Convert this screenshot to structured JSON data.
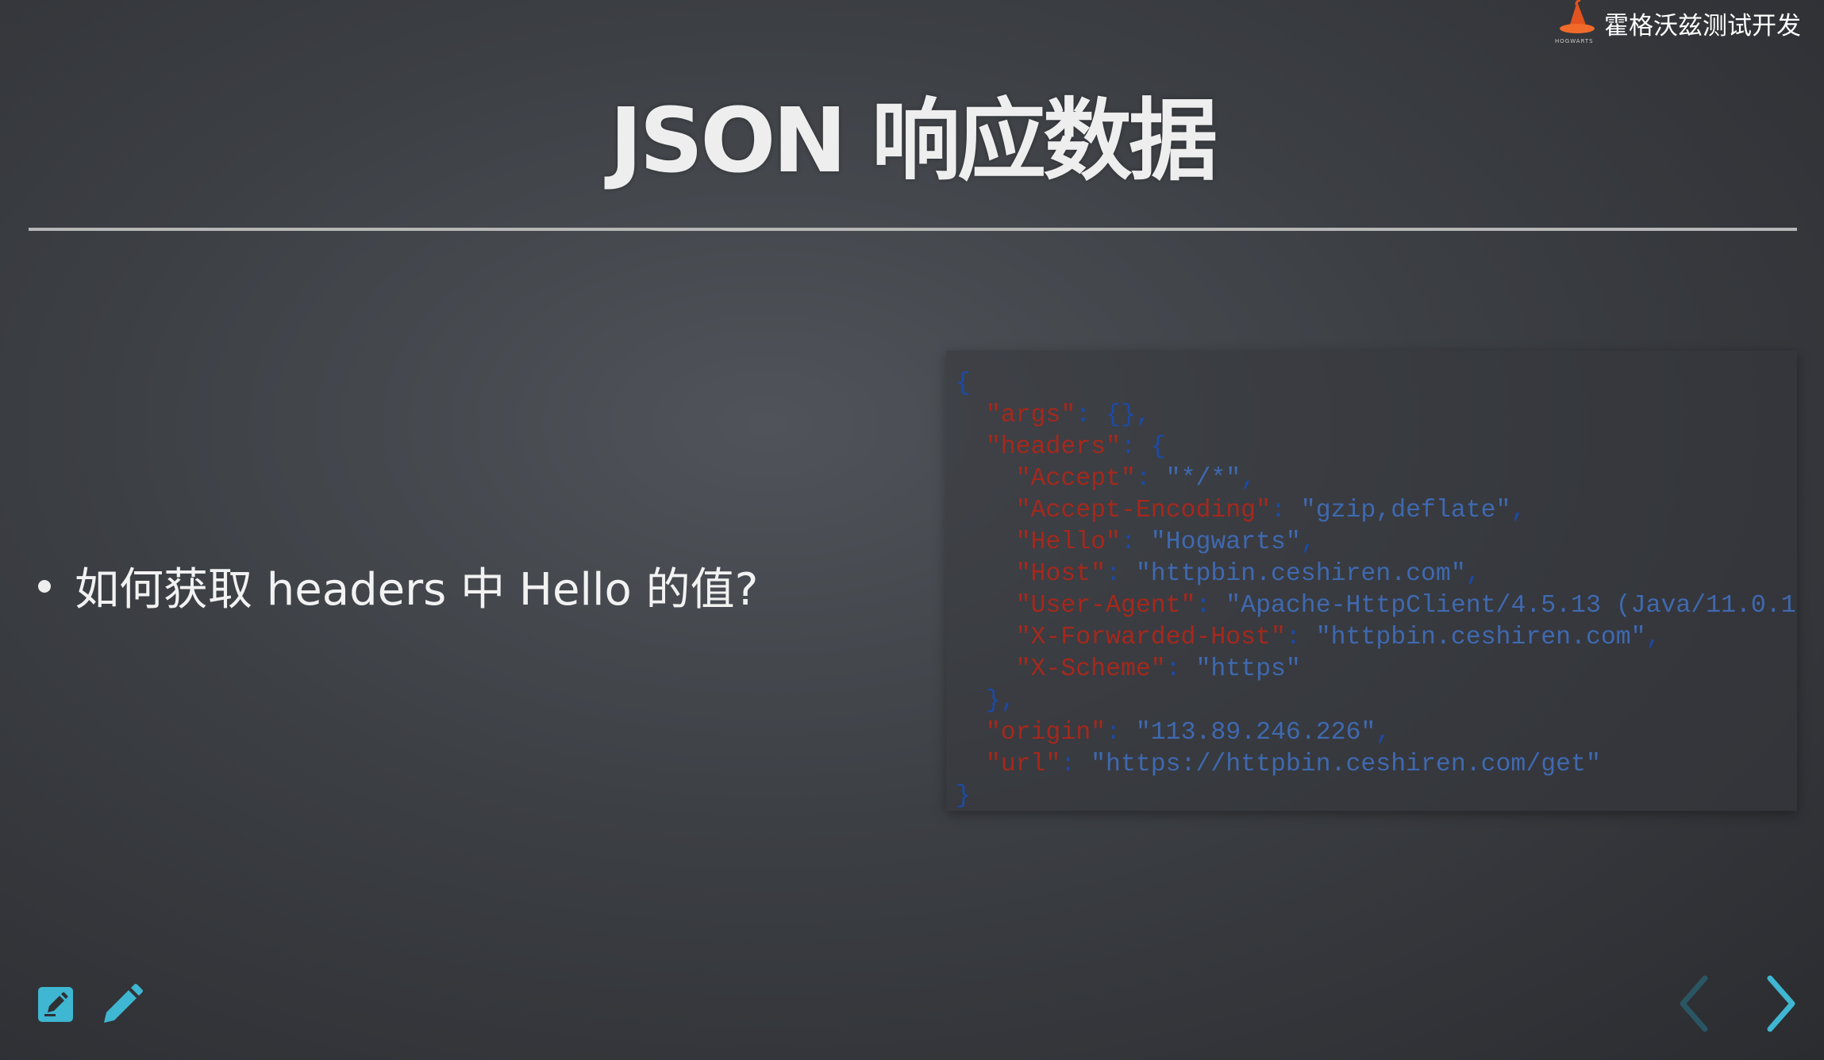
{
  "brand": {
    "name": "霍格沃兹测试开发",
    "logo_icon": "wizard-hat-icon"
  },
  "slide": {
    "title": "JSON 响应数据",
    "bullet": "如何获取 headers 中 Hello 的值?"
  },
  "code_sample": {
    "l1": "{",
    "l2_key": "\"args\"",
    "l2_rest": ": {},",
    "l3_key": "\"headers\"",
    "l3_rest": ": {",
    "l4_key": "\"Accept\"",
    "l4_sep": ": ",
    "l4_val": "\"*/*\"",
    "l4_end": ",",
    "l5_key": "\"Accept-Encoding\"",
    "l5_sep": ": ",
    "l5_val": "\"gzip,deflate\"",
    "l5_end": ",",
    "l6_key": "\"Hello\"",
    "l6_sep": ": ",
    "l6_val": "\"Hogwarts\"",
    "l6_end": ",",
    "l7_key": "\"Host\"",
    "l7_sep": ": ",
    "l7_val": "\"httpbin.ceshiren.com\"",
    "l7_end": ",",
    "l8_key": "\"User-Agent\"",
    "l8_sep": ": ",
    "l8_val": "\"Apache-HttpClient/4.5.13 (Java/11.0.1",
    "l9_key": "\"X-Forwarded-Host\"",
    "l9_sep": ": ",
    "l9_val": "\"httpbin.ceshiren.com\"",
    "l9_end": ",",
    "l10_key": "\"X-Scheme\"",
    "l10_sep": ": ",
    "l10_val": "\"https\"",
    "l11": "},",
    "l12_key": "\"origin\"",
    "l12_sep": ": ",
    "l12_val": "\"113.89.246.226\"",
    "l12_end": ",",
    "l13_key": "\"url\"",
    "l13_sep": ": ",
    "l13_val": "\"https://httpbin.ceshiren.com/get\"",
    "l14": "}"
  },
  "toolbar": {
    "notes_icon": "speaker-notes-icon",
    "pen_icon": "pencil-icon"
  },
  "navigation": {
    "prev_icon": "chevron-left-icon",
    "next_icon": "chevron-right-icon"
  },
  "colors": {
    "accent": "#3fb6d2",
    "json_key": "#a5281c",
    "json_string": "#3f69b0",
    "json_punct": "#1c4aa6"
  }
}
